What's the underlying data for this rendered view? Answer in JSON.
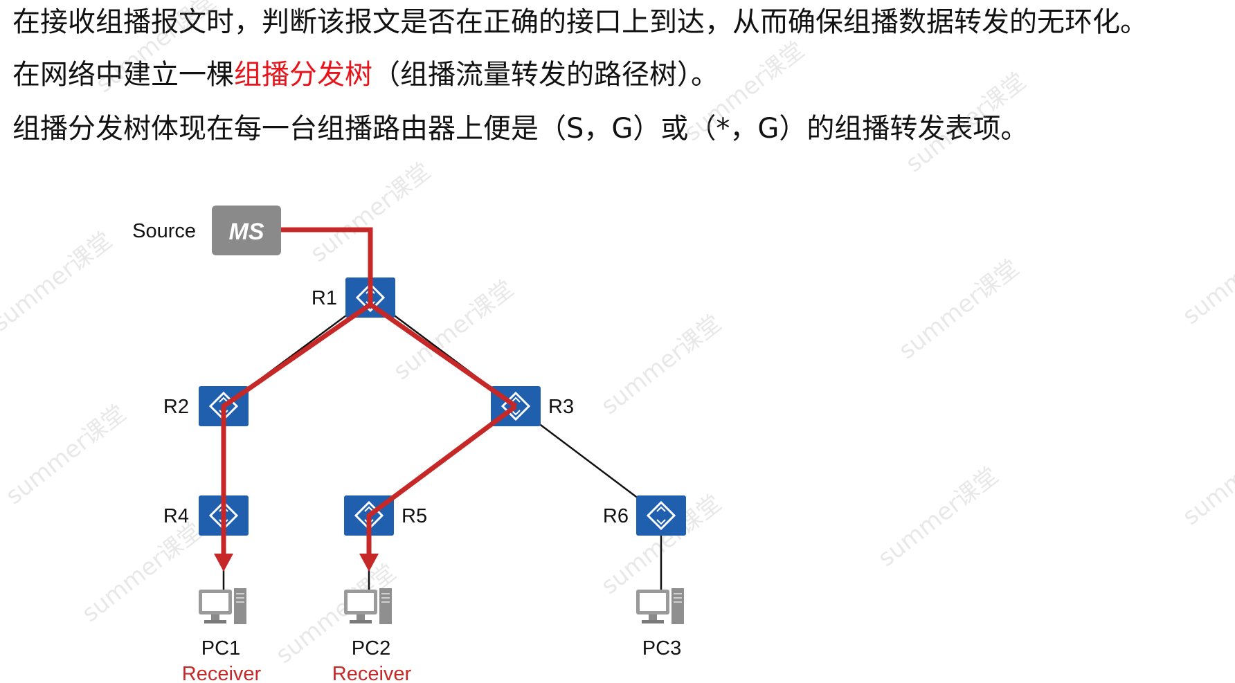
{
  "text": {
    "line1": "在接收组播报文时，判断该报文是否在正确的接口上到达，从而确保组播数据转发的无环化。",
    "line2_pre": "在网络中建立一棵",
    "line2_highlight": "组播分发树",
    "line2_post": "（组播流量转发的路径树）。",
    "line3": "组播分发树体现在每一台组播路由器上便是（S，G）或（*，G）的组播转发表项。"
  },
  "diagram": {
    "source_label": "Source",
    "source_icon_text": "MS",
    "routers": [
      {
        "id": "R1",
        "label": "R1"
      },
      {
        "id": "R2",
        "label": "R2"
      },
      {
        "id": "R3",
        "label": "R3"
      },
      {
        "id": "R4",
        "label": "R4"
      },
      {
        "id": "R5",
        "label": "R5"
      },
      {
        "id": "R6",
        "label": "R6"
      }
    ],
    "pcs": [
      {
        "id": "PC1",
        "label": "PC1",
        "role": "Receiver"
      },
      {
        "id": "PC2",
        "label": "PC2",
        "role": "Receiver"
      },
      {
        "id": "PC3",
        "label": "PC3",
        "role": ""
      }
    ],
    "watermark": "summer课堂"
  },
  "colors": {
    "highlight": "#e8141b",
    "tree_path": "#c62828",
    "router_fill": "#1f5fae",
    "source_fill": "#8a8a8a"
  }
}
